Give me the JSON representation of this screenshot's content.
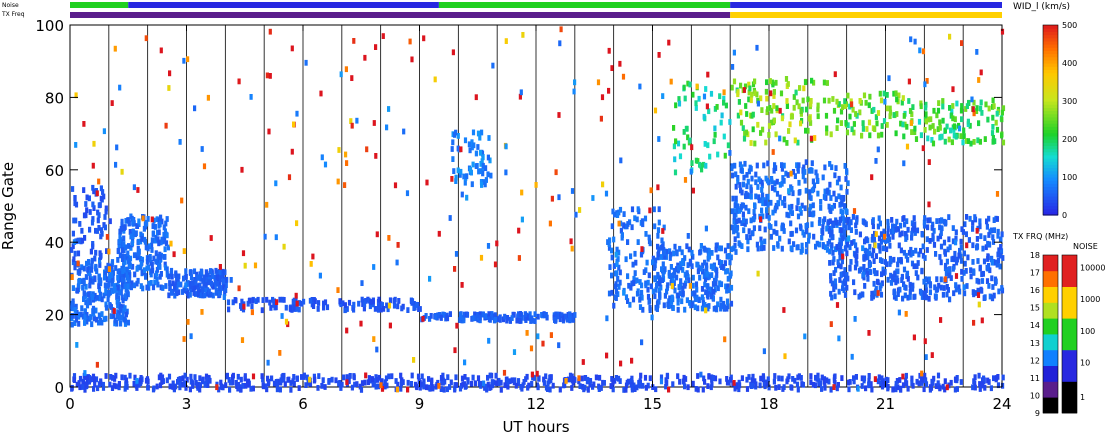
{
  "chart_data": {
    "type": "scatter",
    "xlabel": "UT hours",
    "ylabel": "Range Gate",
    "xlim": [
      0,
      24
    ],
    "ylim": [
      0,
      100
    ],
    "x_ticks": [
      "0",
      "3",
      "6",
      "9",
      "12",
      "15",
      "18",
      "21",
      "24"
    ],
    "y_ticks": [
      "0",
      "20",
      "40",
      "60",
      "80",
      "100"
    ],
    "vertical_grid_hours": [
      1,
      2,
      3,
      4,
      5,
      6,
      7,
      8,
      9,
      10,
      11,
      12,
      13,
      14,
      15,
      16,
      17,
      18,
      19,
      20,
      21,
      22,
      23
    ],
    "top_bars": {
      "noise_label": "Noise",
      "txfreq_label": "TX Freq",
      "noise_segments": [
        {
          "from": 0.0,
          "to": 1.5,
          "level": "100"
        },
        {
          "from": 1.5,
          "to": 9.5,
          "level": "10"
        },
        {
          "from": 9.5,
          "to": 17.0,
          "level": "100"
        },
        {
          "from": 17.0,
          "to": 24.0,
          "level": "10"
        }
      ],
      "txfreq_segments": [
        {
          "from": 0.0,
          "to": 17.0,
          "freq": "10"
        },
        {
          "from": 17.0,
          "to": 24.0,
          "freq": "16"
        }
      ]
    },
    "echo_regions": [
      {
        "x": [
          0.0,
          1.5
        ],
        "y": [
          18,
          36
        ],
        "value": 60,
        "n": 260
      },
      {
        "x": [
          1.2,
          2.5
        ],
        "y": [
          28,
          48
        ],
        "value": 60,
        "n": 220
      },
      {
        "x": [
          2.5,
          4.0
        ],
        "y": [
          26,
          33
        ],
        "value": 50,
        "n": 160
      },
      {
        "x": [
          0.0,
          1.0
        ],
        "y": [
          36,
          56
        ],
        "value": 40,
        "n": 70
      },
      {
        "x": [
          4.0,
          9.0
        ],
        "y": [
          22,
          25
        ],
        "value": 40,
        "n": 120
      },
      {
        "x": [
          9.0,
          13.0
        ],
        "y": [
          19,
          21
        ],
        "value": 50,
        "n": 140
      },
      {
        "x": [
          9.8,
          10.8
        ],
        "y": [
          56,
          72
        ],
        "value": 80,
        "n": 60
      },
      {
        "x": [
          13.8,
          15.3
        ],
        "y": [
          22,
          50
        ],
        "value": 60,
        "n": 140
      },
      {
        "x": [
          15.0,
          17.0
        ],
        "y": [
          22,
          40
        ],
        "value": 60,
        "n": 260
      },
      {
        "x": [
          15.5,
          17.0
        ],
        "y": [
          60,
          85
        ],
        "value": 180,
        "n": 60
      },
      {
        "x": [
          17.0,
          20.0
        ],
        "y": [
          38,
          63
        ],
        "value": 60,
        "n": 360
      },
      {
        "x": [
          19.5,
          24.0
        ],
        "y": [
          25,
          48
        ],
        "value": 50,
        "n": 520
      },
      {
        "x": [
          17.0,
          19.5
        ],
        "y": [
          68,
          86
        ],
        "value": 250,
        "n": 120
      },
      {
        "x": [
          19.5,
          21.5
        ],
        "y": [
          70,
          82
        ],
        "value": 230,
        "n": 80
      },
      {
        "x": [
          21.5,
          24.0
        ],
        "y": [
          68,
          80
        ],
        "value": 210,
        "n": 120
      },
      {
        "x": [
          0.0,
          24.0
        ],
        "y": [
          0,
          4
        ],
        "value": 30,
        "n": 700
      },
      {
        "x": [
          0.0,
          24.0
        ],
        "y": [
          0,
          100
        ],
        "value": 480,
        "n": 240
      },
      {
        "x": [
          0.0,
          24.0
        ],
        "y": [
          0,
          100
        ],
        "value": 80,
        "n": 120
      }
    ],
    "colorbars": [
      {
        "label": "WID_l (km/s)",
        "ticks": [
          "0",
          "100",
          "200",
          "300",
          "400",
          "500"
        ],
        "min": 0,
        "max": 500
      },
      {
        "label": "TX FRQ (MHz)",
        "ticks": [
          "9",
          "10",
          "11",
          "12",
          "13",
          "14",
          "15",
          "16",
          "17",
          "18"
        ],
        "colors": [
          "#000000",
          "#5a1e8c",
          "#2020d8",
          "#1080ff",
          "#10d0d0",
          "#20d020",
          "#b0e020",
          "#ffd000",
          "#ff7000",
          "#e02020"
        ]
      },
      {
        "label": "NOISE",
        "ticks": [
          "1",
          "10",
          "100",
          "1000",
          "10000"
        ],
        "colors": [
          "#000000",
          "#2828e0",
          "#20d020",
          "#ffd000",
          "#e02020"
        ]
      }
    ]
  }
}
